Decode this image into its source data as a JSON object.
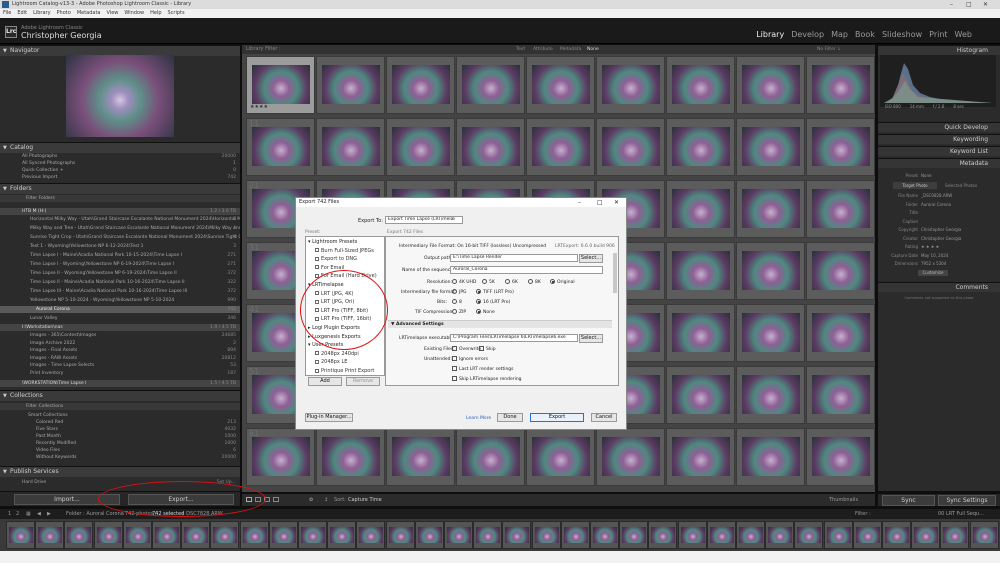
{
  "window": {
    "title": "Lightroom Catalog-v13-3 - Adobe Photoshop Lightroom Classic - Library"
  },
  "menu": [
    "File",
    "Edit",
    "Library",
    "Photo",
    "Metadata",
    "View",
    "Window",
    "Help",
    "Scripts"
  ],
  "identity": {
    "app": "Adobe Lightroom Classic",
    "user": "Christopher Georgia",
    "logo": "Lrc"
  },
  "modules": [
    "Library",
    "Develop",
    "Map",
    "Book",
    "Slideshow",
    "Print",
    "Web"
  ],
  "left": {
    "navigator": "Navigator",
    "catalog": {
      "title": "Catalog",
      "items": [
        {
          "label": "All Photographs",
          "count": "20000"
        },
        {
          "label": "All Synced Photographs",
          "count": "1"
        },
        {
          "label": "Quick Collection +",
          "count": "0"
        },
        {
          "label": "Previous Import",
          "count": "742"
        }
      ]
    },
    "folders": {
      "title": "Folders",
      "filter": "Filter Folders",
      "drive": "HTB M (H:)",
      "drive_info": "1.2 / 3.6 TB",
      "items": [
        "Horizontal Milky Way - Utah\\Grand Staircase Escalante National Monument 2024\\Horizontal Milk",
        "Milky Way and Tree - Utah\\Grand Staircase Escalante National Monument 2024\\Milky Way and Tr",
        "Sunrise Tight Crop - Utah\\Grand Staircase Escalante National Monument 2024\\Sunrise Tight Crop",
        "Test 1 - Wyoming\\Yellowstone NP 6-12-2024\\Test 1",
        "Time Lapse I - Maine\\Acadia National Park 10-15-2024\\Time Lapse I",
        "Time Lapse I - Wyoming\\Yellowstone NP 6-19-2024\\Time Lapse I",
        "Time Lapse II - Wyoming\\Yellowstone NP 6-19-2024\\Time Lapse II",
        "Time Lapse II - Maine\\Acadia National Park 10-16-2024\\Time Lapse II",
        "Time Lapse III - Maine\\Acadia National Park 10-16-2024\\Time Lapse III",
        "Yellowstone NP 5-10-2024 - Wyoming\\Yellowstone NP 5-10-2024",
        "Auroral Corona",
        "Lunar Valley"
      ],
      "counts": [
        "1",
        "4",
        "4",
        "3",
        "271",
        "271",
        "372",
        "322",
        "372",
        "990",
        "742",
        "346"
      ],
      "drive2": "I:\\Workstation\\nas",
      "drive2_info": "1.9 / 4.5 TB",
      "items2": [
        "Images - 365\\Contest\\Images",
        "Image Archive 2022",
        "Images - Final Assets",
        "Images - RAW Assets",
        "Images - Time Lapse Selects",
        "Print Inventory"
      ],
      "counts2": [
        "24685",
        "2",
        "894",
        "20812",
        "53",
        "187"
      ],
      "drive3": "\\WORKSTATION\\Time Lapse I",
      "drive3_info": "1.5 / 4.5 TB"
    },
    "collections": {
      "title": "Collections",
      "filter": "Filter Collections",
      "items": [
        "Smart Collections",
        "Colored Red",
        "Five Stars",
        "Past Month",
        "Recently Modified",
        "Video Files",
        "Without Keywords"
      ],
      "counts": [
        "",
        "213",
        "4032",
        "1000",
        "1000",
        "6",
        "20000"
      ]
    },
    "publish": {
      "title": "Publish Services",
      "item": "Hard Drive",
      "action": "Set Up..."
    },
    "buttons": {
      "import": "Import...",
      "export": "Export..."
    }
  },
  "grid": {
    "filter_label": "Library Filter :",
    "filters": [
      "Text",
      "Attribute",
      "Metadata",
      "None"
    ],
    "filter_right": "No Filter ↓",
    "row_numbers": [
      "11",
      "21",
      "31",
      "41",
      "51",
      "61"
    ],
    "stars": "★★★★",
    "toolbar": {
      "sort_label": "Sort:",
      "sort_value": "Capture Time",
      "thumbnails": "Thumbnails"
    }
  },
  "right": {
    "histogram": "Histogram",
    "exif": [
      "ISO 800",
      "14 mm",
      "f / 2.8",
      "8 sec"
    ],
    "quick_develop": "Quick Develop",
    "keywording": "Keywording",
    "keyword_list": "Keyword List",
    "metadata": "Metadata",
    "preset": "None",
    "tabs": [
      "Target Photo",
      "Selected Photos"
    ],
    "fields": [
      {
        "k": "File Name",
        "v": "_DSC0828.ARW"
      },
      {
        "k": "Folder",
        "v": "Auroral Corona"
      },
      {
        "k": "Title",
        "v": ""
      },
      {
        "k": "Caption",
        "v": ""
      },
      {
        "k": "Copyright",
        "v": "Christopher Georgia"
      },
      {
        "k": "Creator",
        "v": "Christopher Georgia"
      },
      {
        "k": "Rating",
        "v": "★ ★ ★ ★"
      },
      {
        "k": "Capture Date",
        "v": "May 10, 2024"
      },
      {
        "k": "Dimensions",
        "v": "7952 x 5304"
      }
    ],
    "customize": "Customize",
    "comments": "Comments",
    "comments_note": "Comments not supported on this photo",
    "sync": "Sync",
    "sync_settings": "Sync Settings"
  },
  "filmstrip": {
    "source": "Folder : Auroral Corona",
    "photos": "742 photos /",
    "selected": "742 selected",
    "file": "/_DSC7828.ARW",
    "filter": "Filter :",
    "filter_value": "00 LRT Full Sequ..."
  },
  "dialog": {
    "title": "Export 742 Files",
    "export_to_label": "Export To:",
    "export_to_value": "Export Time Lapse (LRTimelæ",
    "preset_label": "Preset:",
    "right_header": "Export 742 Files",
    "presets": [
      {
        "t": "Lightroom Presets",
        "sub": false
      },
      {
        "t": "Burn Full-Sized JPEGs",
        "sub": true
      },
      {
        "t": "Export to DNG",
        "sub": true
      },
      {
        "t": "For Email",
        "sub": true
      },
      {
        "t": "For Email (Hard Drive)",
        "sub": true
      },
      {
        "t": "LRTimelapse",
        "sub": false
      },
      {
        "t": "LRT (JPG, 4K)",
        "sub": true
      },
      {
        "t": "LRT (JPG, Ori)",
        "sub": true
      },
      {
        "t": "LRT Pro (TIFF, 8bit)",
        "sub": true
      },
      {
        "t": "LRT Pro (TIFF, 16bit)",
        "sub": true
      },
      {
        "t": "Logi Plugin Exports",
        "sub": false
      },
      {
        "t": "Luxgenesis Exports",
        "sub": false
      },
      {
        "t": "User Presets",
        "sub": false
      },
      {
        "t": "2048px 240dpi",
        "sub": true
      },
      {
        "t": "2048px LE",
        "sub": true
      },
      {
        "t": "Printique Print Export",
        "sub": true
      }
    ],
    "add": "Add",
    "remove": "Remove",
    "fmt_line": "Intermediary File Format: On  16-bit  TIFF (lossless)  Uncompressed",
    "version": "LRTExport: 6.6.0 build 906",
    "output_label": "Output path:",
    "output_value": "E:\\Time Lapse Render",
    "select": "Select...",
    "seq_label": "Name of the sequence:",
    "seq_value": "Auroral_Corona",
    "res_label": "Resolution:",
    "res_opts": [
      "4K UHD",
      "5K",
      "6K",
      "8K",
      "Original"
    ],
    "fmt_label": "Intermediary file format:",
    "fmt_opts": [
      "JPG",
      "TIFF (LRT Pro)"
    ],
    "bits_label": "Bits:",
    "bits_opts": [
      "8",
      "16 (LRT Pro)"
    ],
    "tiff_label": "TIF Compression:",
    "tiff_opts": [
      "ZIP",
      "None"
    ],
    "adv": "Advanced Settings",
    "exe_label": "LRTimelapse executable:",
    "exe_value": "C:\\Program Files\\LRTimelapse 6\\LRTimelapse6.exe",
    "exist_label": "Existing Files:",
    "exist_opts": [
      "Overwrite",
      "Skip"
    ],
    "unatt_label": "Unattended:",
    "checks": [
      "Ignore errors",
      "Last LRT render settings",
      "Skip LRTimelapse rendering"
    ],
    "plugin": "Plug-in Manager...",
    "learn": "Learn More",
    "done": "Done",
    "export": "Export",
    "cancel": "Cancel"
  }
}
